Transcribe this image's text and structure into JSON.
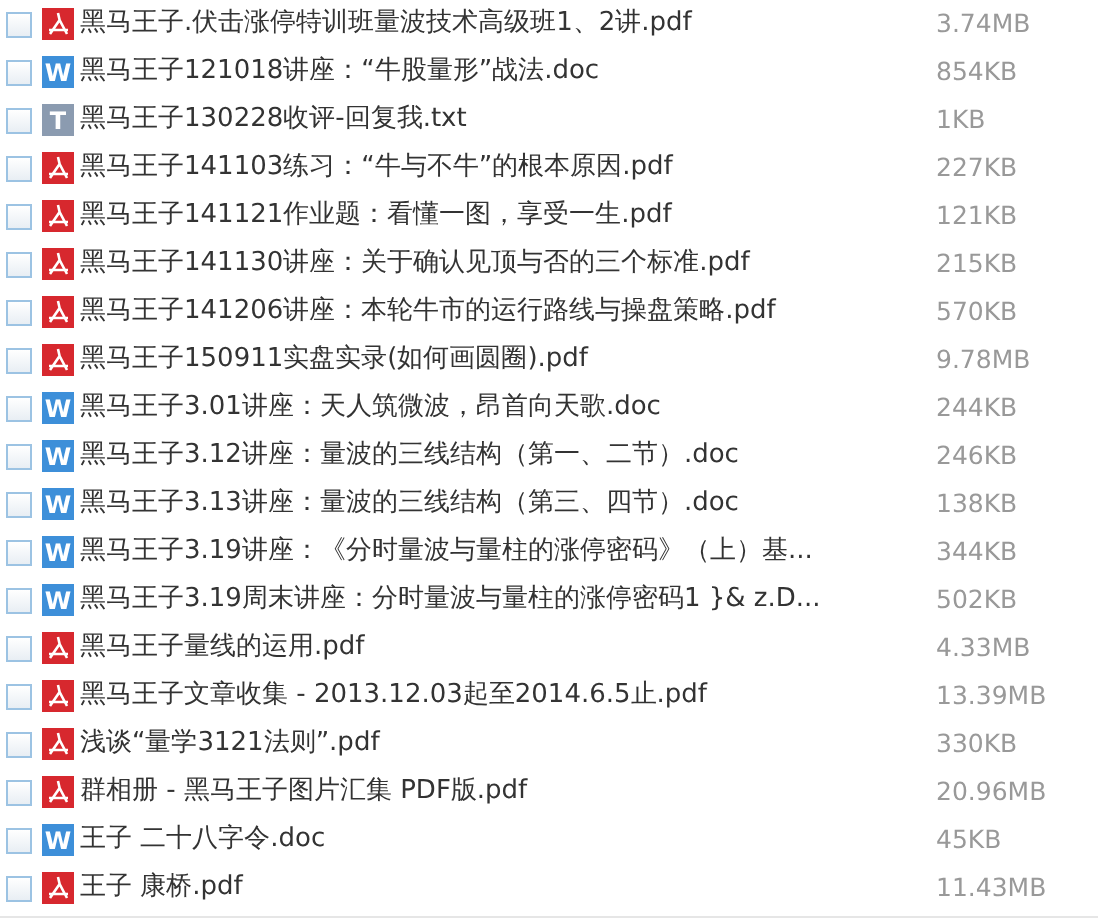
{
  "files": [
    {
      "kind": "pdf",
      "checked": false,
      "name": "黑马王子.伏击涨停特训班量波技术高级班1、2讲.pdf",
      "size": "3.74MB"
    },
    {
      "kind": "doc",
      "icon_text": "W",
      "checked": false,
      "name": "黑马王子121018讲座：“牛股量形”战法.doc",
      "size": "854KB"
    },
    {
      "kind": "txt",
      "icon_text": "T",
      "checked": false,
      "name": "黑马王子130228收评-回复我.txt",
      "size": "1KB"
    },
    {
      "kind": "pdf",
      "checked": false,
      "name": "黑马王子141103练习：“牛与不牛”的根本原因.pdf",
      "size": "227KB"
    },
    {
      "kind": "pdf",
      "checked": false,
      "name": "黑马王子141121作业题：看懂一图，享受一生.pdf",
      "size": "121KB"
    },
    {
      "kind": "pdf",
      "checked": false,
      "name": "黑马王子141130讲座：关于确认见顶与否的三个标准.pdf",
      "size": "215KB"
    },
    {
      "kind": "pdf",
      "checked": false,
      "name": "黑马王子141206讲座：本轮牛市的运行路线与操盘策略.pdf",
      "size": "570KB"
    },
    {
      "kind": "pdf",
      "checked": false,
      "name": "黑马王子150911实盘实录(如何画圆圈).pdf",
      "size": "9.78MB"
    },
    {
      "kind": "doc",
      "icon_text": "W",
      "checked": false,
      "name": "黑马王子3.01讲座：天人筑微波，昂首向天歌.doc",
      "size": "244KB"
    },
    {
      "kind": "doc",
      "icon_text": "W",
      "checked": false,
      "name": "黑马王子3.12讲座：量波的三线结构（第一、二节）.doc",
      "size": "246KB"
    },
    {
      "kind": "doc",
      "icon_text": "W",
      "checked": false,
      "name": "黑马王子3.13讲座：量波的三线结构（第三、四节）.doc",
      "size": "138KB"
    },
    {
      "kind": "doc",
      "icon_text": "W",
      "checked": false,
      "name": "黑马王子3.19讲座：《分时量波与量柱的涨停密码》（上）基...",
      "size": "344KB"
    },
    {
      "kind": "doc",
      "icon_text": "W",
      "checked": false,
      "name": "黑马王子3.19周末讲座：分时量波与量柱的涨停密码1 }& z.D...",
      "size": "502KB"
    },
    {
      "kind": "pdf",
      "checked": false,
      "name": "黑马王子量线的运用.pdf",
      "size": "4.33MB"
    },
    {
      "kind": "pdf",
      "checked": false,
      "name": "黑马王子文章收集 - 2013.12.03起至2014.6.5止.pdf",
      "size": "13.39MB"
    },
    {
      "kind": "pdf",
      "checked": false,
      "name": "浅谈“量学3121法则”.pdf",
      "size": "330KB"
    },
    {
      "kind": "pdf",
      "checked": false,
      "name": "群相册 - 黑马王子图片汇集  PDF版.pdf",
      "size": "20.96MB"
    },
    {
      "kind": "doc",
      "icon_text": "W",
      "checked": false,
      "name": "王子 二十八字令.doc",
      "size": "45KB"
    },
    {
      "kind": "pdf",
      "checked": false,
      "name": "王子 康桥.pdf",
      "size": "11.43MB"
    }
  ]
}
